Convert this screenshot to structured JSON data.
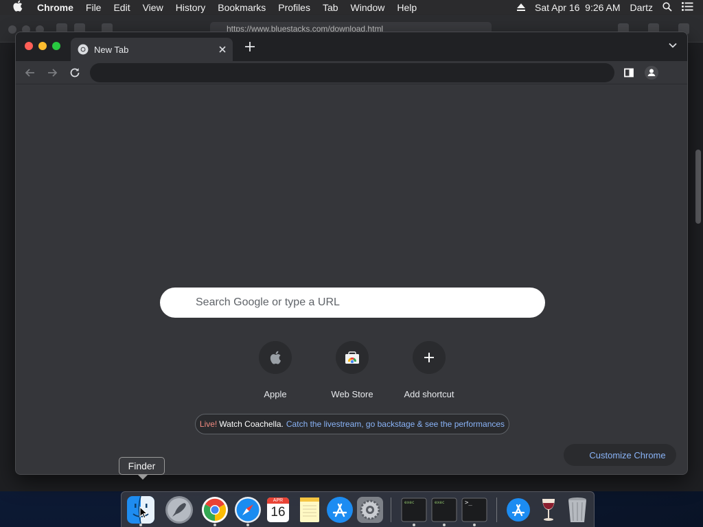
{
  "menubar": {
    "app_name": "Chrome",
    "items": [
      "File",
      "Edit",
      "View",
      "History",
      "Bookmarks",
      "Profiles",
      "Tab",
      "Window",
      "Help"
    ],
    "datetime": "Sat Apr 16  9:26 AM",
    "user": "Dartz",
    "icons": [
      "apple-icon",
      "eject-icon",
      "spotlight-search-icon",
      "control-center-icon"
    ]
  },
  "background_window": {
    "url": "https://www.bluestacks.com/download.html"
  },
  "chrome": {
    "tab": {
      "title": "New Tab",
      "favicon": "chrome-icon"
    },
    "toolbar_icons": [
      "back-arrow-icon",
      "forward-arrow-icon",
      "reload-icon",
      "side-panel-icon",
      "profile-icon"
    ],
    "omnibox_value": ""
  },
  "ntp": {
    "search_placeholder": "Search Google or type a URL",
    "shortcuts": [
      {
        "label": "Apple",
        "icon": "apple-logo-icon"
      },
      {
        "label": "Web Store",
        "icon": "chrome-web-store-icon"
      },
      {
        "label": "Add shortcut",
        "icon": "plus-icon"
      }
    ],
    "promo": {
      "live": "Live!",
      "headline": "Watch Coachella.",
      "link": "Catch the livestream, go backstage & see the performances"
    },
    "customize_label": "Customize Chrome"
  },
  "dock": {
    "tooltip": "Finder",
    "items": [
      {
        "name": "finder",
        "running": true
      },
      {
        "name": "launchpad",
        "running": false
      },
      {
        "name": "chrome",
        "running": true
      },
      {
        "name": "safari",
        "running": true
      },
      {
        "name": "calendar",
        "running": false,
        "month": "APR",
        "day": "16"
      },
      {
        "name": "notes",
        "running": false
      },
      {
        "name": "app-store",
        "running": false
      },
      {
        "name": "system-preferences",
        "running": false
      },
      {
        "name": "terminal-exec-1",
        "running": true,
        "label": "exec"
      },
      {
        "name": "terminal-exec-2",
        "running": true,
        "label": "exec"
      },
      {
        "name": "terminal",
        "running": true,
        "label": ">_"
      },
      {
        "name": "app-store-downloads",
        "running": false
      },
      {
        "name": "wine",
        "running": false
      },
      {
        "name": "trash",
        "running": false
      }
    ]
  },
  "colors": {
    "accent_link": "#8ab4f8",
    "live_red": "#f28b82",
    "window_bg": "#35363a",
    "tabstrip_bg": "#202124"
  }
}
